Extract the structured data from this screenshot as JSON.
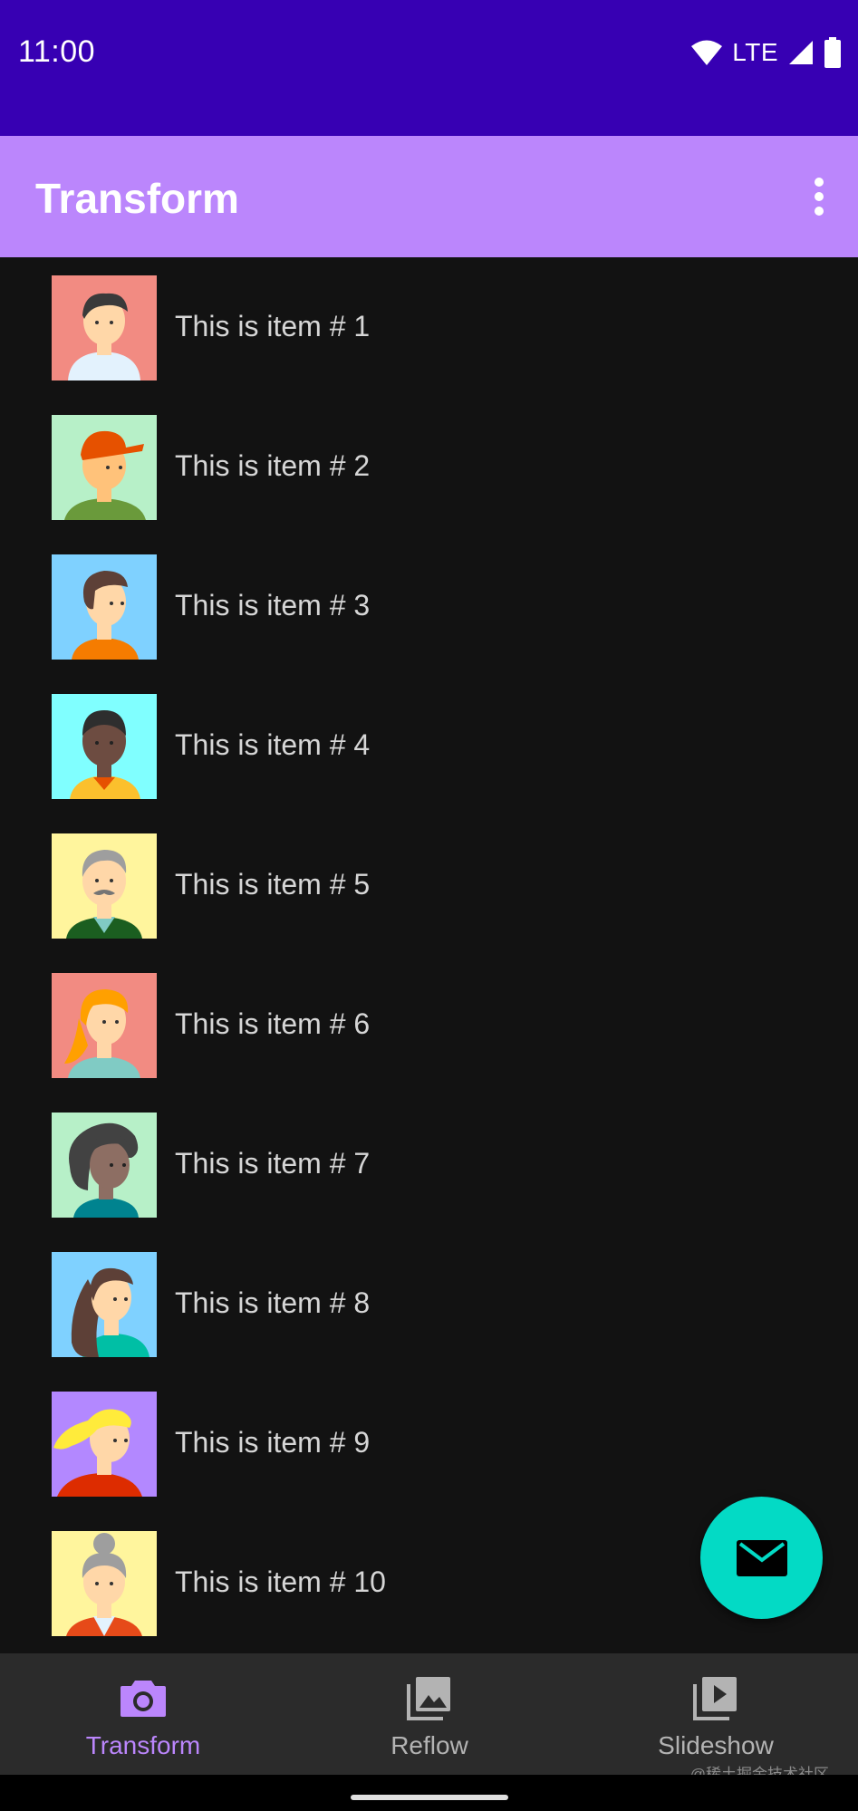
{
  "status_bar": {
    "time": "11:00",
    "network": "LTE",
    "icons": [
      "wifi-icon",
      "signal-icon",
      "battery-icon"
    ],
    "background": "#3700b3"
  },
  "app_bar": {
    "title": "Transform",
    "background": "#bb86fc",
    "menu_icon": "more-vert-icon"
  },
  "list": {
    "items": [
      {
        "label": "This is item # 1",
        "avatar": "avatar-man-dark-hair",
        "bg": "#f28b82"
      },
      {
        "label": "This is item # 2",
        "avatar": "avatar-man-red-cap",
        "bg": "#b7f0c8"
      },
      {
        "label": "This is item # 3",
        "avatar": "avatar-man-brown-hair",
        "bg": "#7fd1ff"
      },
      {
        "label": "This is item # 4",
        "avatar": "avatar-man-dark-skin",
        "bg": "#80ffff"
      },
      {
        "label": "This is item # 5",
        "avatar": "avatar-old-man-mustache",
        "bg": "#fff59d"
      },
      {
        "label": "This is item # 6",
        "avatar": "avatar-woman-blonde",
        "bg": "#f28b82"
      },
      {
        "label": "This is item # 7",
        "avatar": "avatar-woman-curly-hair",
        "bg": "#b7f0c8"
      },
      {
        "label": "This is item # 8",
        "avatar": "avatar-woman-long-hair",
        "bg": "#7fd1ff"
      },
      {
        "label": "This is item # 9",
        "avatar": "avatar-woman-yellow-hair",
        "bg": "#b388ff"
      },
      {
        "label": "This is item # 10",
        "avatar": "avatar-old-woman-bun",
        "bg": "#fff59d"
      }
    ]
  },
  "fab": {
    "icon": "mail-icon",
    "color": "#03dac5"
  },
  "bottom_nav": {
    "items": [
      {
        "label": "Transform",
        "icon": "camera-icon",
        "active": true
      },
      {
        "label": "Reflow",
        "icon": "image-icon",
        "active": false
      },
      {
        "label": "Slideshow",
        "icon": "slideshow-icon",
        "active": false
      }
    ],
    "active_color": "#bb86fc"
  },
  "watermark": "@稀土掘金技术社区"
}
